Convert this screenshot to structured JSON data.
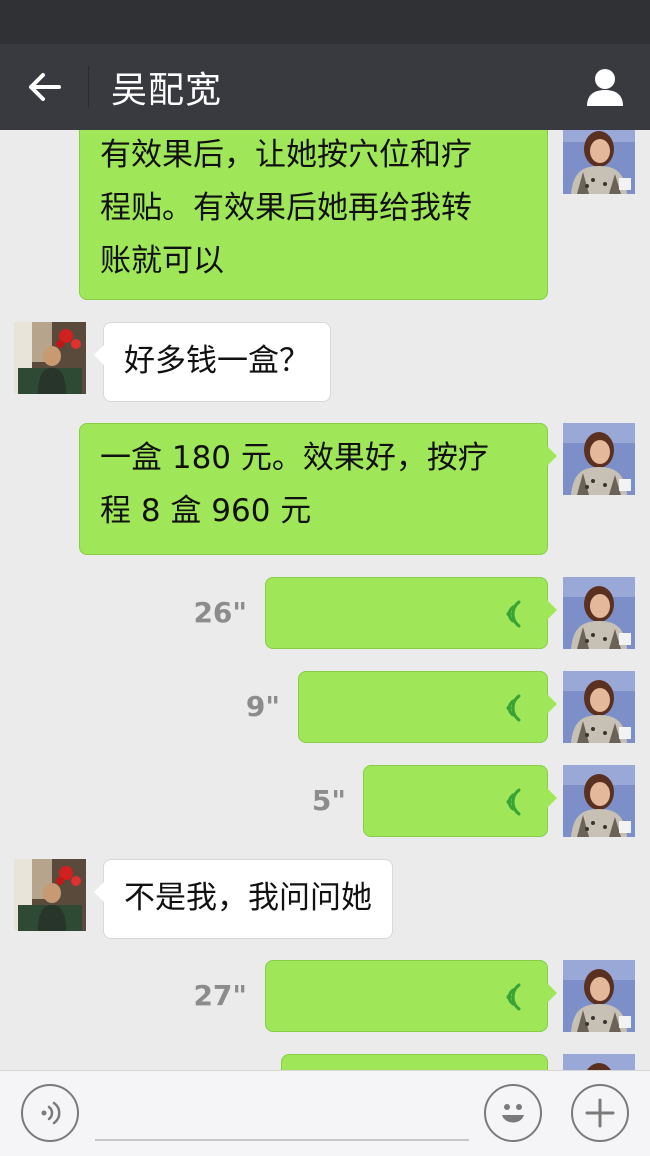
{
  "header": {
    "title": "吴配宽",
    "back_icon": "arrow-left-icon",
    "profile_icon": "person-icon"
  },
  "messages": [
    {
      "type": "text",
      "from": "self",
      "lines": [
        "有效果后，让她按穴位和疗",
        "程贴。有效果后她再给我转",
        "账就可以"
      ]
    },
    {
      "type": "text",
      "from": "other",
      "lines": [
        "好多钱一盒？"
      ]
    },
    {
      "type": "text",
      "from": "self",
      "lines": [
        "一盒 180 元。效果好，按疗",
        "程 8 盒 960 元"
      ]
    },
    {
      "type": "voice",
      "from": "self",
      "duration": "26\""
    },
    {
      "type": "voice",
      "from": "self",
      "duration": "9\""
    },
    {
      "type": "voice",
      "from": "self",
      "duration": "5\""
    },
    {
      "type": "text",
      "from": "other",
      "lines": [
        "不是我，我问问她"
      ]
    },
    {
      "type": "voice",
      "from": "self",
      "duration": "27\""
    },
    {
      "type": "voice",
      "from": "self",
      "duration": ""
    }
  ],
  "input_bar": {
    "voice_icon": "voice-mode-icon",
    "emoji_icon": "emoji-icon",
    "plus_icon": "plus-icon",
    "text_value": ""
  },
  "colors": {
    "title_bar": "#393a3f",
    "status_bar": "#2f3134",
    "self_bubble": "#9fe658",
    "other_bubble": "#ffffff",
    "chat_background": "#ebebeb"
  }
}
